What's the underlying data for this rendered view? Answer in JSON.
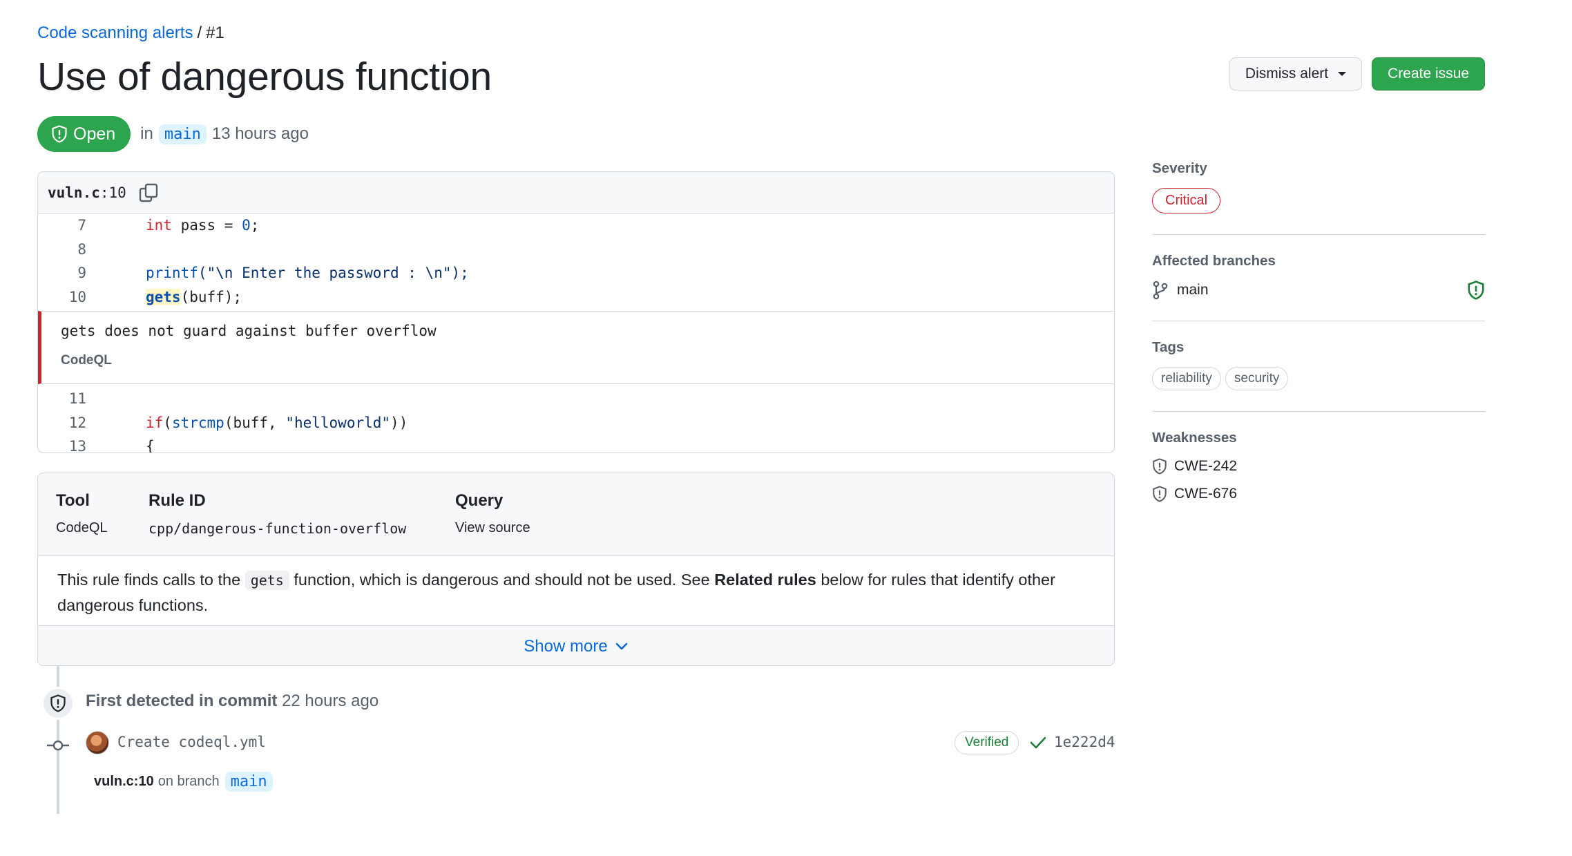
{
  "breadcrumb": {
    "link": "Code scanning alerts",
    "separator": "/",
    "current": "#1"
  },
  "title": "Use of dangerous function",
  "actions": {
    "dismiss": "Dismiss alert",
    "create_issue": "Create issue"
  },
  "status": {
    "badge": "Open",
    "in": "in",
    "branch": "main",
    "time": "13 hours ago"
  },
  "code": {
    "file": "vuln.c",
    "line_suffix": ":10",
    "lines_before": [
      {
        "num": "7",
        "type": "int",
        "rest": " pass = ",
        "val": "0",
        "end": ";"
      },
      {
        "num": "8"
      },
      {
        "num": "9",
        "fn": "printf",
        "args": "(\"\\n Enter the password : \\n\");"
      },
      {
        "num": "10",
        "hl": "gets",
        "args": "(buff);"
      }
    ],
    "alert_message": "gets does not guard against buffer overflow",
    "alert_source": "CodeQL",
    "lines_after": [
      {
        "num": "11"
      },
      {
        "num": "12",
        "kw": "if",
        "paren": "(",
        "fn": "strcmp",
        "args": "(buff, ",
        "str": "\"helloworld\"",
        "end": "))"
      },
      {
        "num": "13",
        "text": "{"
      }
    ]
  },
  "rule": {
    "tool_label": "Tool",
    "tool_value": "CodeQL",
    "id_label": "Rule ID",
    "id_value": "cpp/dangerous-function-overflow",
    "query_label": "Query",
    "query_value": "View source",
    "desc_1": "This rule finds calls to the ",
    "desc_code": "gets",
    "desc_2": " function, which is dangerous and should not be used. See ",
    "desc_bold": "Related rules",
    "desc_3": " below for rules that identify other dangerous functions.",
    "show_more": "Show more"
  },
  "timeline": {
    "title_bold": "First detected in commit",
    "title_time": "22 hours ago",
    "commit_message": "Create codeql.yml",
    "verified": "Verified",
    "sha": "1e222d4",
    "location": "vuln.c:10",
    "on_branch": "on branch",
    "branch": "main"
  },
  "sidebar": {
    "severity_label": "Severity",
    "severity": "Critical",
    "branches_label": "Affected branches",
    "branch": "main",
    "tags_label": "Tags",
    "tags": [
      "reliability",
      "security"
    ],
    "weaknesses_label": "Weaknesses",
    "weaknesses": [
      "CWE-242",
      "CWE-676"
    ]
  },
  "colors": {
    "accent_green": "#2da44e",
    "link_blue": "#0969da",
    "critical_red": "#cf222e"
  },
  "icons": [
    "shield-icon",
    "copy-icon",
    "caret-down-icon",
    "chevron-down-icon",
    "git-commit-icon",
    "check-icon",
    "git-branch-icon",
    "shield-alert-icon"
  ]
}
